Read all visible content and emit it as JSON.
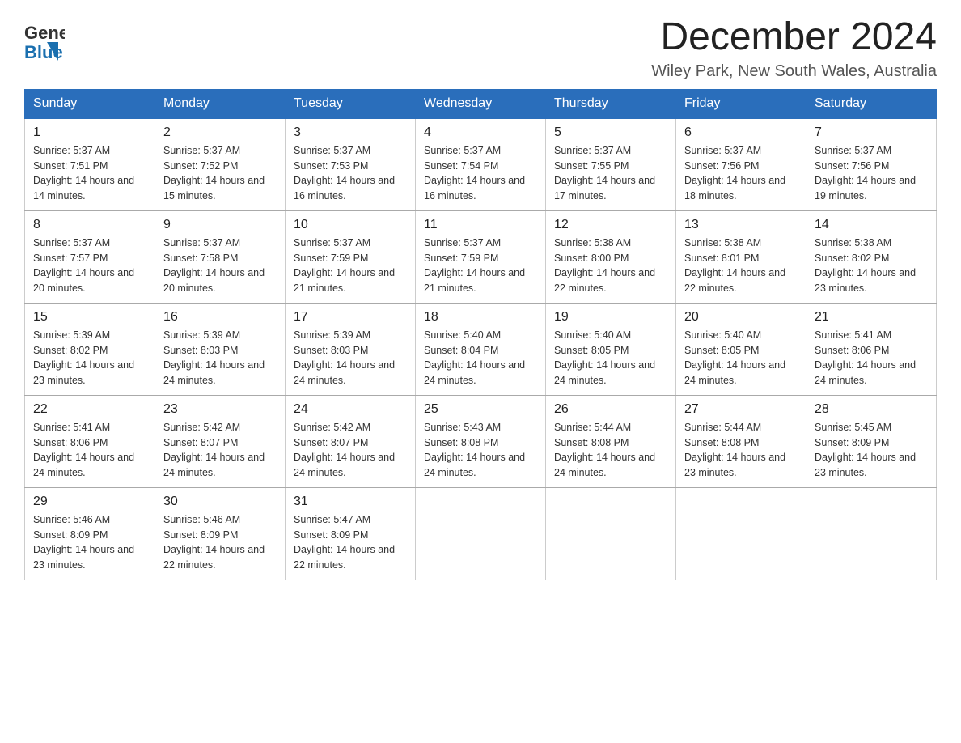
{
  "header": {
    "logo_general": "General",
    "logo_blue": "Blue",
    "title": "December 2024",
    "subtitle": "Wiley Park, New South Wales, Australia"
  },
  "weekdays": [
    "Sunday",
    "Monday",
    "Tuesday",
    "Wednesday",
    "Thursday",
    "Friday",
    "Saturday"
  ],
  "weeks": [
    [
      {
        "day": "1",
        "sunrise": "5:37 AM",
        "sunset": "7:51 PM",
        "daylight": "14 hours and 14 minutes."
      },
      {
        "day": "2",
        "sunrise": "5:37 AM",
        "sunset": "7:52 PM",
        "daylight": "14 hours and 15 minutes."
      },
      {
        "day": "3",
        "sunrise": "5:37 AM",
        "sunset": "7:53 PM",
        "daylight": "14 hours and 16 minutes."
      },
      {
        "day": "4",
        "sunrise": "5:37 AM",
        "sunset": "7:54 PM",
        "daylight": "14 hours and 16 minutes."
      },
      {
        "day": "5",
        "sunrise": "5:37 AM",
        "sunset": "7:55 PM",
        "daylight": "14 hours and 17 minutes."
      },
      {
        "day": "6",
        "sunrise": "5:37 AM",
        "sunset": "7:56 PM",
        "daylight": "14 hours and 18 minutes."
      },
      {
        "day": "7",
        "sunrise": "5:37 AM",
        "sunset": "7:56 PM",
        "daylight": "14 hours and 19 minutes."
      }
    ],
    [
      {
        "day": "8",
        "sunrise": "5:37 AM",
        "sunset": "7:57 PM",
        "daylight": "14 hours and 20 minutes."
      },
      {
        "day": "9",
        "sunrise": "5:37 AM",
        "sunset": "7:58 PM",
        "daylight": "14 hours and 20 minutes."
      },
      {
        "day": "10",
        "sunrise": "5:37 AM",
        "sunset": "7:59 PM",
        "daylight": "14 hours and 21 minutes."
      },
      {
        "day": "11",
        "sunrise": "5:37 AM",
        "sunset": "7:59 PM",
        "daylight": "14 hours and 21 minutes."
      },
      {
        "day": "12",
        "sunrise": "5:38 AM",
        "sunset": "8:00 PM",
        "daylight": "14 hours and 22 minutes."
      },
      {
        "day": "13",
        "sunrise": "5:38 AM",
        "sunset": "8:01 PM",
        "daylight": "14 hours and 22 minutes."
      },
      {
        "day": "14",
        "sunrise": "5:38 AM",
        "sunset": "8:02 PM",
        "daylight": "14 hours and 23 minutes."
      }
    ],
    [
      {
        "day": "15",
        "sunrise": "5:39 AM",
        "sunset": "8:02 PM",
        "daylight": "14 hours and 23 minutes."
      },
      {
        "day": "16",
        "sunrise": "5:39 AM",
        "sunset": "8:03 PM",
        "daylight": "14 hours and 24 minutes."
      },
      {
        "day": "17",
        "sunrise": "5:39 AM",
        "sunset": "8:03 PM",
        "daylight": "14 hours and 24 minutes."
      },
      {
        "day": "18",
        "sunrise": "5:40 AM",
        "sunset": "8:04 PM",
        "daylight": "14 hours and 24 minutes."
      },
      {
        "day": "19",
        "sunrise": "5:40 AM",
        "sunset": "8:05 PM",
        "daylight": "14 hours and 24 minutes."
      },
      {
        "day": "20",
        "sunrise": "5:40 AM",
        "sunset": "8:05 PM",
        "daylight": "14 hours and 24 minutes."
      },
      {
        "day": "21",
        "sunrise": "5:41 AM",
        "sunset": "8:06 PM",
        "daylight": "14 hours and 24 minutes."
      }
    ],
    [
      {
        "day": "22",
        "sunrise": "5:41 AM",
        "sunset": "8:06 PM",
        "daylight": "14 hours and 24 minutes."
      },
      {
        "day": "23",
        "sunrise": "5:42 AM",
        "sunset": "8:07 PM",
        "daylight": "14 hours and 24 minutes."
      },
      {
        "day": "24",
        "sunrise": "5:42 AM",
        "sunset": "8:07 PM",
        "daylight": "14 hours and 24 minutes."
      },
      {
        "day": "25",
        "sunrise": "5:43 AM",
        "sunset": "8:08 PM",
        "daylight": "14 hours and 24 minutes."
      },
      {
        "day": "26",
        "sunrise": "5:44 AM",
        "sunset": "8:08 PM",
        "daylight": "14 hours and 24 minutes."
      },
      {
        "day": "27",
        "sunrise": "5:44 AM",
        "sunset": "8:08 PM",
        "daylight": "14 hours and 23 minutes."
      },
      {
        "day": "28",
        "sunrise": "5:45 AM",
        "sunset": "8:09 PM",
        "daylight": "14 hours and 23 minutes."
      }
    ],
    [
      {
        "day": "29",
        "sunrise": "5:46 AM",
        "sunset": "8:09 PM",
        "daylight": "14 hours and 23 minutes."
      },
      {
        "day": "30",
        "sunrise": "5:46 AM",
        "sunset": "8:09 PM",
        "daylight": "14 hours and 22 minutes."
      },
      {
        "day": "31",
        "sunrise": "5:47 AM",
        "sunset": "8:09 PM",
        "daylight": "14 hours and 22 minutes."
      },
      null,
      null,
      null,
      null
    ]
  ]
}
